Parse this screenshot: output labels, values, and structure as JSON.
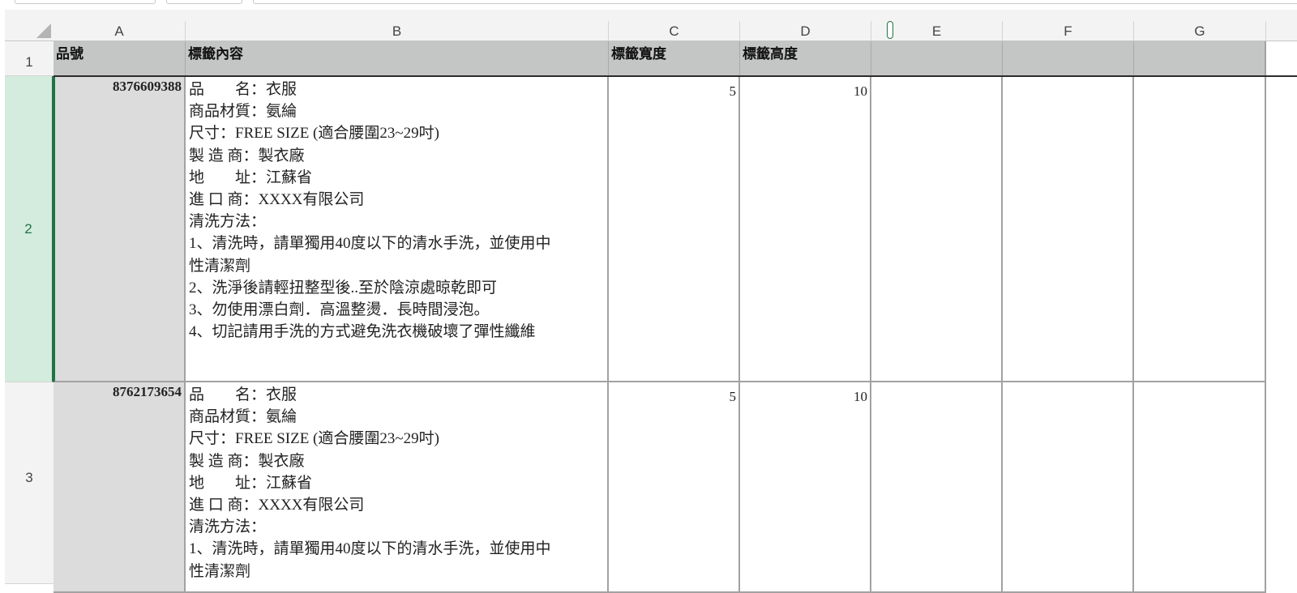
{
  "columns": [
    "A",
    "B",
    "C",
    "D",
    "E",
    "F",
    "G"
  ],
  "rows": [
    "1",
    "2",
    "3"
  ],
  "header_row": {
    "a": "品號",
    "b": "標籤內容",
    "c": "標籤寬度",
    "d": "標籤高度"
  },
  "records": [
    {
      "id": "8376609388",
      "width": "5",
      "height": "10",
      "lines": [
        "品　　名：衣服",
        "商品材質：氨綸",
        "尺寸：FREE SIZE (適合腰圍23~29吋)",
        "製 造 商：製衣廠",
        "地　　址：江蘇省",
        "進 口 商：XXXX有限公司",
        "清洗方法：",
        "1、清洗時，請單獨用40度以下的清水手洗，並使用中",
        "性清潔劑",
        "2、洗淨後請輕扭整型後..至於陰涼處晾乾即可",
        "3、勿使用漂白劑．高溫整燙．長時間浸泡。",
        "4、切記請用手洗的方式避免洗衣機破壞了彈性纖維"
      ]
    },
    {
      "id": "8762173654",
      "width": "5",
      "height": "10",
      "lines": [
        "品　　名：衣服",
        "商品材質：氨綸",
        "尺寸：FREE SIZE (適合腰圍23~29吋)",
        "製 造 商：製衣廠",
        "地　　址：江蘇省",
        "進 口 商：XXXX有限公司",
        "清洗方法：",
        "1、清洗時，請單獨用40度以下的清水手洗，並使用中",
        "性清潔劑"
      ]
    }
  ],
  "colors": {
    "header_fill": "#c4c6c5",
    "id_column_fill": "#dcdcdc",
    "selected_row_header": "#d3ecdd",
    "accent": "#217346"
  }
}
